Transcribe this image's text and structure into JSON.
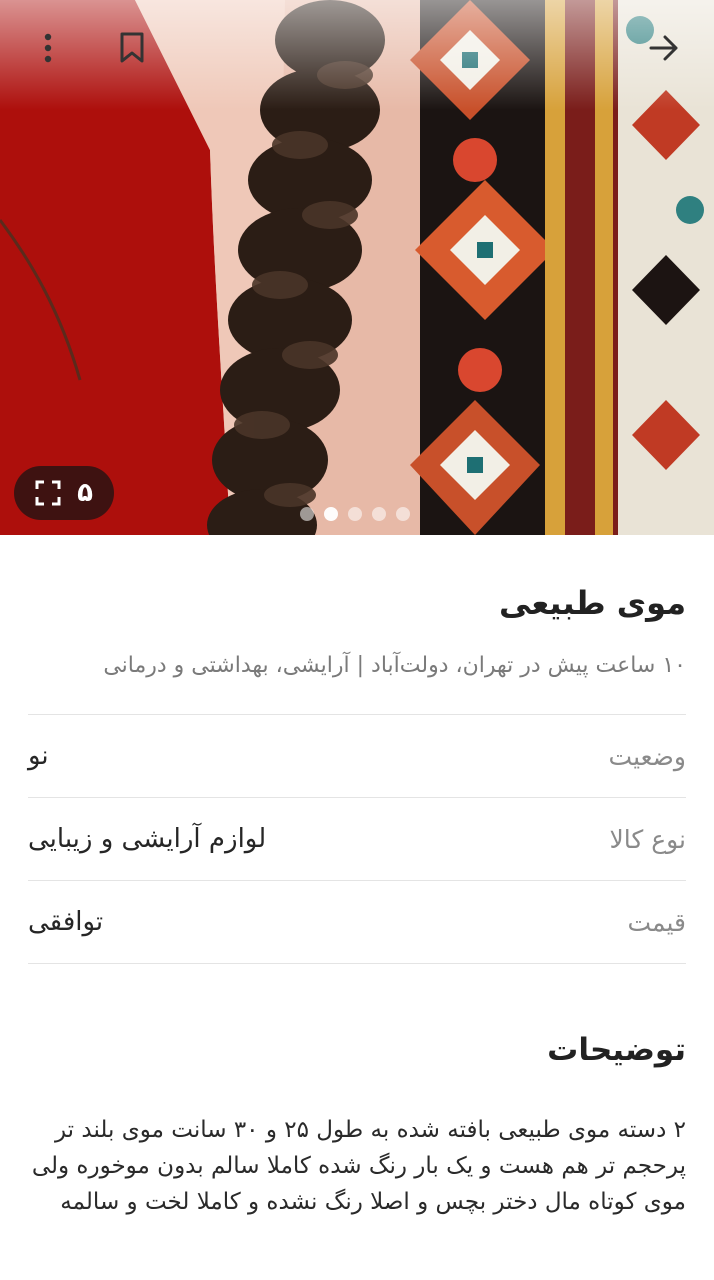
{
  "image": {
    "photo_count": "۵",
    "active_dot": 1,
    "dots": 5
  },
  "icons": {
    "more": "more-vertical-icon",
    "bookmark": "bookmark-icon",
    "back": "arrow-right-icon",
    "fullscreen": "fullscreen-icon"
  },
  "ad": {
    "title": "موی طبیعی",
    "subtitle": "۱۰ ساعت پیش در تهران، دولت‌آباد | آرایشی، بهداشتی و درمانی",
    "details": [
      {
        "label": "وضعیت",
        "value": "نو"
      },
      {
        "label": "نوع کالا",
        "value": "لوازم آرایشی و زیبایی"
      },
      {
        "label": "قیمت",
        "value": "توافقی"
      }
    ],
    "description_title": "توضیحات",
    "description": "۲ دسته موی طبیعی بافته شده به طول ۲۵ و ۳۰ سانت موی بلند تر پرحجم تر هم هست و یک بار رنگ شده کاملا سالم بدون موخوره ولی موی کوتاه مال دختر بچس و اصلا رنگ نشده و کاملا لخت و سالمه"
  }
}
